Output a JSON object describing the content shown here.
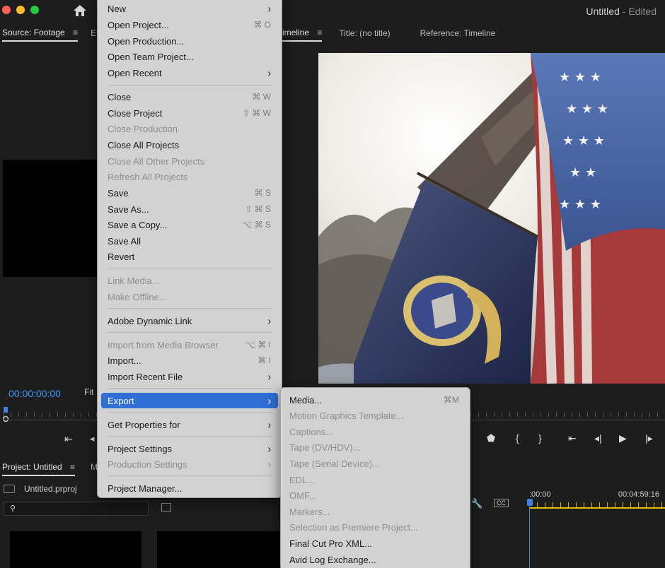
{
  "window": {
    "title": "Untitled",
    "status": "- Edited"
  },
  "source_panel": {
    "tabs": [
      "Source: Footage",
      "Eff"
    ],
    "timecode": "00:00:00:00",
    "fit_label": "Fit"
  },
  "program_panel": {
    "tabs": [
      "imeline",
      "Title: (no title)",
      "Reference: Timeline"
    ]
  },
  "project_panel": {
    "tabs": [
      "Project: Untitled",
      "M"
    ],
    "file_name": "Untitled.prproj"
  },
  "timeline": {
    "start_time": ":00:00",
    "end_time": "00:04:59:16"
  },
  "file_menu": {
    "items": [
      {
        "label": "New",
        "shortcut": "",
        "submenu": true,
        "disabled": false
      },
      {
        "label": "Open Project...",
        "shortcut": "⌘ O",
        "submenu": false,
        "disabled": false
      },
      {
        "label": "Open Production...",
        "shortcut": "",
        "submenu": false,
        "disabled": false
      },
      {
        "label": "Open Team Project...",
        "shortcut": "",
        "submenu": false,
        "disabled": false
      },
      {
        "label": "Open Recent",
        "shortcut": "",
        "submenu": true,
        "disabled": false
      },
      {
        "label": "Close",
        "shortcut": "⌘ W",
        "submenu": false,
        "disabled": false
      },
      {
        "label": "Close Project",
        "shortcut": "⇧ ⌘ W",
        "submenu": false,
        "disabled": false
      },
      {
        "label": "Close Production",
        "shortcut": "",
        "submenu": false,
        "disabled": true
      },
      {
        "label": "Close All Projects",
        "shortcut": "",
        "submenu": false,
        "disabled": false
      },
      {
        "label": "Close All Other Projects",
        "shortcut": "",
        "submenu": false,
        "disabled": true
      },
      {
        "label": "Refresh All Projects",
        "shortcut": "",
        "submenu": false,
        "disabled": true
      },
      {
        "label": "Save",
        "shortcut": "⌘ S",
        "submenu": false,
        "disabled": false
      },
      {
        "label": "Save As...",
        "shortcut": "⇧ ⌘ S",
        "submenu": false,
        "disabled": false
      },
      {
        "label": "Save a Copy...",
        "shortcut": "⌥ ⌘ S",
        "submenu": false,
        "disabled": false
      },
      {
        "label": "Save All",
        "shortcut": "",
        "submenu": false,
        "disabled": false
      },
      {
        "label": "Revert",
        "shortcut": "",
        "submenu": false,
        "disabled": false
      },
      {
        "label": "Link Media...",
        "shortcut": "",
        "submenu": false,
        "disabled": true
      },
      {
        "label": "Make Offline...",
        "shortcut": "",
        "submenu": false,
        "disabled": true
      },
      {
        "label": "Adobe Dynamic Link",
        "shortcut": "",
        "submenu": true,
        "disabled": false
      },
      {
        "label": "Import from Media Browser",
        "shortcut": "⌥ ⌘ I",
        "submenu": false,
        "disabled": true
      },
      {
        "label": "Import...",
        "shortcut": "⌘ I",
        "submenu": false,
        "disabled": false
      },
      {
        "label": "Import Recent File",
        "shortcut": "",
        "submenu": true,
        "disabled": false
      },
      {
        "label": "Export",
        "shortcut": "",
        "submenu": true,
        "disabled": false,
        "highlighted": true
      },
      {
        "label": "Get Properties for",
        "shortcut": "",
        "submenu": true,
        "disabled": false
      },
      {
        "label": "Project Settings",
        "shortcut": "",
        "submenu": true,
        "disabled": false
      },
      {
        "label": "Production Settings",
        "shortcut": "",
        "submenu": true,
        "disabled": true
      },
      {
        "label": "Project Manager...",
        "shortcut": "",
        "submenu": false,
        "disabled": false
      }
    ]
  },
  "export_menu": {
    "items": [
      {
        "label": "Media...",
        "shortcut": "⌘M",
        "disabled": false
      },
      {
        "label": "Motion Graphics Template...",
        "shortcut": "",
        "disabled": true
      },
      {
        "label": "Captions...",
        "shortcut": "",
        "disabled": true
      },
      {
        "label": "Tape (DV/HDV)...",
        "shortcut": "",
        "disabled": true
      },
      {
        "label": "Tape (Serial Device)...",
        "shortcut": "",
        "disabled": true
      },
      {
        "label": "EDL...",
        "shortcut": "",
        "disabled": true
      },
      {
        "label": "OMF...",
        "shortcut": "",
        "disabled": true
      },
      {
        "label": "Markers...",
        "shortcut": "",
        "disabled": true
      },
      {
        "label": "Selection as Premiere Project...",
        "shortcut": "",
        "disabled": true
      },
      {
        "label": "Final Cut Pro XML...",
        "shortcut": "",
        "disabled": false
      },
      {
        "label": "Avid Log Exchange...",
        "shortcut": "",
        "disabled": false
      }
    ]
  }
}
